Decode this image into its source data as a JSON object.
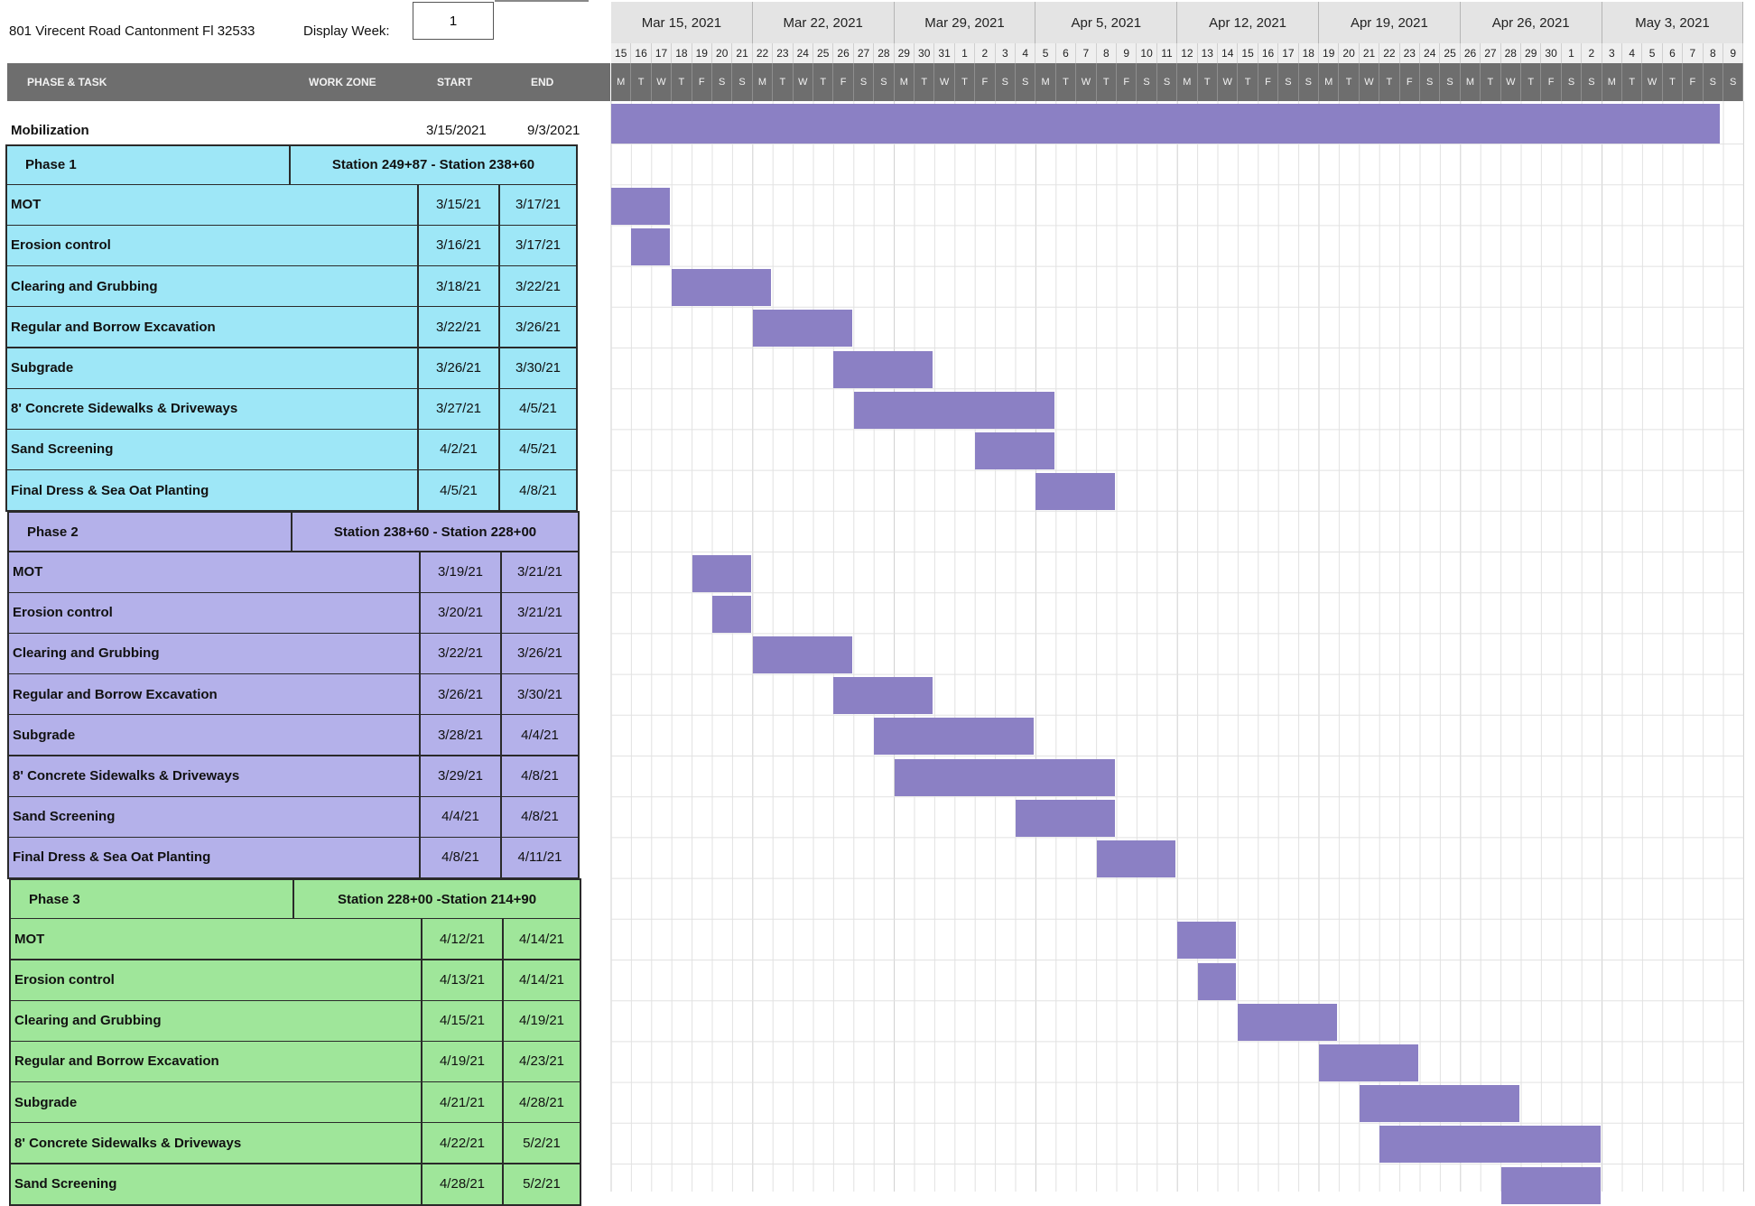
{
  "header": {
    "address": "801 Virecent Road Cantonment Fl 32533",
    "display_week_label": "Display Week:",
    "display_week_value": "1",
    "col_phase_task": "PHASE & TASK",
    "col_work_zone": "WORK ZONE",
    "col_start": "START",
    "col_end": "END"
  },
  "weeks": [
    "Mar 15, 2021",
    "Mar 22, 2021",
    "Mar 29, 2021",
    "Apr 5, 2021",
    "Apr 12, 2021",
    "Apr 19, 2021",
    "Apr 26, 2021",
    "May 3, 2021"
  ],
  "day_numbers": [
    "15",
    "16",
    "17",
    "18",
    "19",
    "20",
    "21",
    "22",
    "23",
    "24",
    "25",
    "26",
    "27",
    "28",
    "29",
    "30",
    "31",
    "1",
    "2",
    "3",
    "4",
    "5",
    "6",
    "7",
    "8",
    "9",
    "10",
    "11",
    "12",
    "13",
    "14",
    "15",
    "16",
    "17",
    "18",
    "19",
    "20",
    "21",
    "22",
    "23",
    "24",
    "25",
    "26",
    "27",
    "28",
    "29",
    "30",
    "1",
    "2",
    "3",
    "4",
    "5",
    "6",
    "7",
    "8",
    "9"
  ],
  "day_letters": [
    "M",
    "T",
    "W",
    "T",
    "F",
    "S",
    "S"
  ],
  "mobilization": {
    "label": "Mobilization",
    "start": "3/15/2021",
    "end": "9/3/2021",
    "start_day": 0,
    "end_day": 54.8
  },
  "phases": [
    {
      "name": "Phase 1",
      "zone": "Station 249+87 - Station 238+60",
      "color": "#9ee7f7",
      "tasks": [
        {
          "name": "MOT",
          "start": "3/15/21",
          "end": "3/17/21",
          "bar_start": 0,
          "bar_len": 3
        },
        {
          "name": "Erosion control",
          "start": "3/16/21",
          "end": "3/17/21",
          "bar_start": 1,
          "bar_len": 2
        },
        {
          "name": "Clearing and Grubbing",
          "start": "3/18/21",
          "end": "3/22/21",
          "bar_start": 3,
          "bar_len": 5
        },
        {
          "name": "Regular and Borrow Excavation",
          "start": "3/22/21",
          "end": "3/26/21",
          "bar_start": 7,
          "bar_len": 5
        },
        {
          "name": "Subgrade",
          "start": "3/26/21",
          "end": "3/30/21",
          "bar_start": 11,
          "bar_len": 5
        },
        {
          "name": "8' Concrete Sidewalks & Driveways",
          "start": "3/27/21",
          "end": "4/5/21",
          "bar_start": 12,
          "bar_len": 10
        },
        {
          "name": "Sand Screening",
          "start": "4/2/21",
          "end": "4/5/21",
          "bar_start": 18,
          "bar_len": 4
        },
        {
          "name": "Final Dress & Sea Oat Planting",
          "start": "4/5/21",
          "end": "4/8/21",
          "bar_start": 21,
          "bar_len": 4
        }
      ]
    },
    {
      "name": "Phase 2",
      "zone": "Station 238+60 - Station 228+00",
      "color": "#b4b1ea",
      "tasks": [
        {
          "name": "MOT",
          "start": "3/19/21",
          "end": "3/21/21",
          "bar_start": 4,
          "bar_len": 3
        },
        {
          "name": "Erosion control",
          "start": "3/20/21",
          "end": "3/21/21",
          "bar_start": 5,
          "bar_len": 2
        },
        {
          "name": "Clearing and Grubbing",
          "start": "3/22/21",
          "end": "3/26/21",
          "bar_start": 7,
          "bar_len": 5
        },
        {
          "name": "Regular and Borrow Excavation",
          "start": "3/26/21",
          "end": "3/30/21",
          "bar_start": 11,
          "bar_len": 5
        },
        {
          "name": "Subgrade",
          "start": "3/28/21",
          "end": "4/4/21",
          "bar_start": 13,
          "bar_len": 8
        },
        {
          "name": "8' Concrete Sidewalks & Driveways",
          "start": "3/29/21",
          "end": "4/8/21",
          "bar_start": 14,
          "bar_len": 11
        },
        {
          "name": "Sand Screening",
          "start": "4/4/21",
          "end": "4/8/21",
          "bar_start": 20,
          "bar_len": 5
        },
        {
          "name": "Final Dress & Sea Oat Planting",
          "start": "4/8/21",
          "end": "4/11/21",
          "bar_start": 24,
          "bar_len": 4
        }
      ]
    },
    {
      "name": "Phase 3",
      "zone": "Station 228+00 -Station 214+90",
      "color": "#9fe69a",
      "tasks": [
        {
          "name": "MOT",
          "start": "4/12/21",
          "end": "4/14/21",
          "bar_start": 28,
          "bar_len": 3
        },
        {
          "name": "Erosion control",
          "start": "4/13/21",
          "end": "4/14/21",
          "bar_start": 29,
          "bar_len": 2
        },
        {
          "name": "Clearing and Grubbing",
          "start": "4/15/21",
          "end": "4/19/21",
          "bar_start": 31,
          "bar_len": 5
        },
        {
          "name": "Regular and Borrow Excavation",
          "start": "4/19/21",
          "end": "4/23/21",
          "bar_start": 35,
          "bar_len": 5
        },
        {
          "name": "Subgrade",
          "start": "4/21/21",
          "end": "4/28/21",
          "bar_start": 37,
          "bar_len": 8
        },
        {
          "name": "8' Concrete Sidewalks & Driveways",
          "start": "4/22/21",
          "end": "5/2/21",
          "bar_start": 38,
          "bar_len": 11
        },
        {
          "name": "Sand Screening",
          "start": "4/28/21",
          "end": "5/2/21",
          "bar_start": 44,
          "bar_len": 5
        }
      ]
    }
  ],
  "colors": {
    "bar": "#8b80c4",
    "header_band": "#6e6e6e",
    "grid": "#e2e2e2"
  }
}
